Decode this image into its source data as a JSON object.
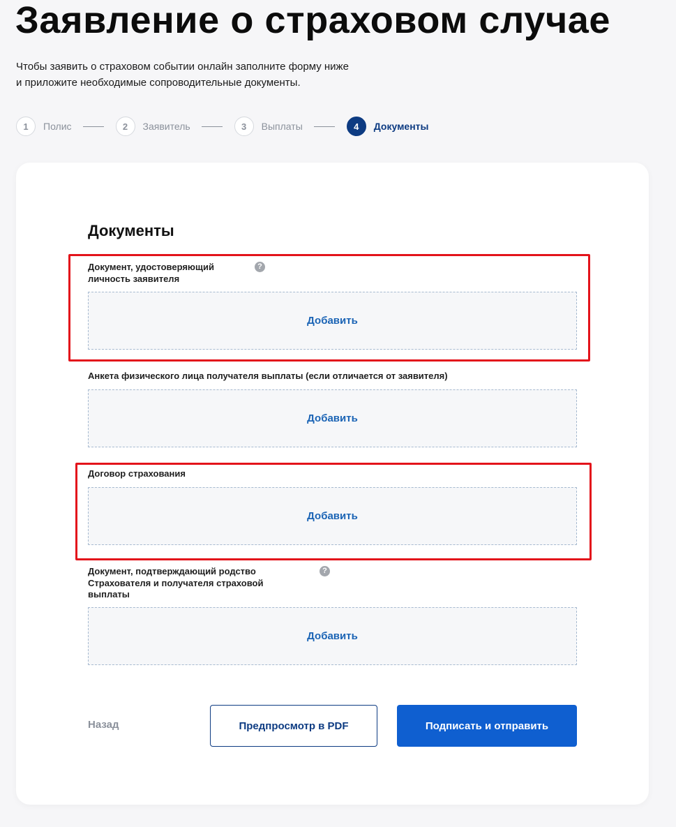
{
  "page": {
    "title": "Заявление о страховом случае",
    "subtitle_line1": "Чтобы заявить о страховом событии онлайн заполните форму ниже",
    "subtitle_line2": "и приложите необходимые сопроводительные документы."
  },
  "stepper": {
    "current_step": 4,
    "steps": [
      {
        "number": "1",
        "label": "Полис"
      },
      {
        "number": "2",
        "label": "Заявитель"
      },
      {
        "number": "3",
        "label": "Выплаты"
      },
      {
        "number": "4",
        "label": "Документы"
      }
    ]
  },
  "form": {
    "section_title": "Документы",
    "documents": [
      {
        "label_line1": "Документ, удостоверяющий",
        "label_line2": "личность заявителя",
        "label_line3": "",
        "has_help": true,
        "add_label": "Добавить"
      },
      {
        "label_line1": "Анкета физического лица получателя выплаты (если отличается от заявителя)",
        "label_line2": "",
        "label_line3": "",
        "has_help": false,
        "add_label": "Добавить"
      },
      {
        "label_line1": "Договор страхования",
        "label_line2": "",
        "label_line3": "",
        "has_help": false,
        "add_label": "Добавить"
      },
      {
        "label_line1": "Документ, подтверждающий родство",
        "label_line2": "Страхователя и получателя страховой",
        "label_line3": "выплаты",
        "has_help": true,
        "add_label": "Добавить"
      }
    ],
    "help_glyph": "?"
  },
  "actions": {
    "back_label": "Назад",
    "preview_label": "Предпросмотр в PDF",
    "submit_label": "Подписать и отправить"
  },
  "colors": {
    "accent": "#0d3b82",
    "primary_button": "#0f5fd0",
    "link": "#1b64b5",
    "highlight": "#e3131b"
  }
}
